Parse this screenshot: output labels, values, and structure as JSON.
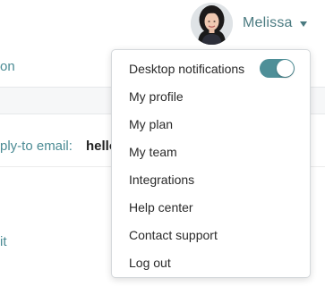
{
  "header": {
    "user_name": "Melissa"
  },
  "background": {
    "nav_fragment": "on",
    "reply_to_label": "ply-to email:",
    "reply_to_value": "hello",
    "edit_link": "it"
  },
  "menu": {
    "items": [
      {
        "label": "Desktop notifications"
      },
      {
        "label": "My profile"
      },
      {
        "label": "My plan"
      },
      {
        "label": "My team"
      },
      {
        "label": "Integrations"
      },
      {
        "label": "Help center"
      },
      {
        "label": "Contact support"
      },
      {
        "label": "Log out"
      }
    ],
    "desktop_notifications_enabled": true
  },
  "colors": {
    "accent": "#4e8f98",
    "link": "#4b8b94"
  }
}
